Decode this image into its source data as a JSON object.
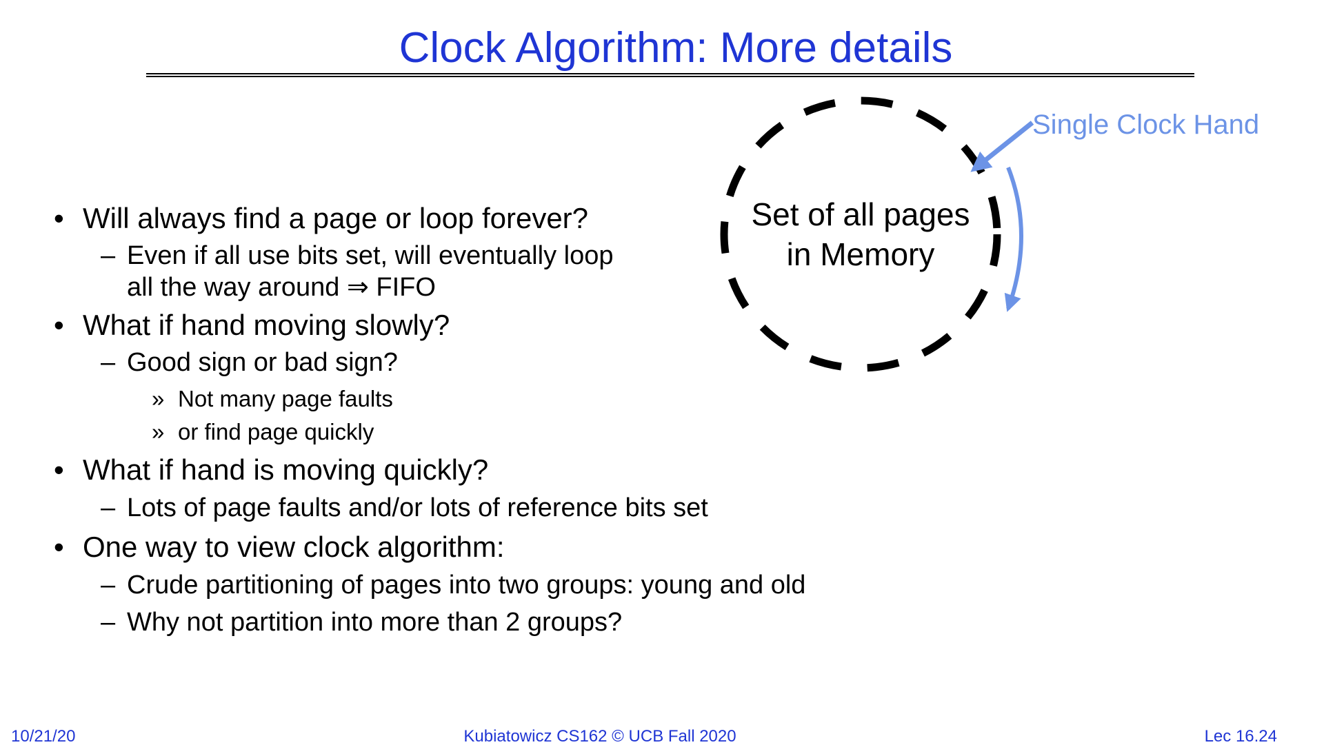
{
  "slide": {
    "title": "Clock Algorithm: More details",
    "bullet_glyph": "•",
    "dash_glyph": "–",
    "sub_glyph": "»",
    "items": [
      {
        "text": "Will always find a page or loop forever?"
      },
      {
        "text": "Even if all use bits set, will eventually loop"
      },
      {
        "text": "all the way around ⇒ FIFO"
      },
      {
        "text": "What if hand moving slowly?"
      },
      {
        "text": "Good sign or bad sign?"
      },
      {
        "text": "Not many page faults"
      },
      {
        "text": "or find page quickly"
      },
      {
        "text": "What if hand is moving quickly?"
      },
      {
        "text": "Lots of page faults and/or lots of reference bits set"
      },
      {
        "text": "One way to view clock algorithm:"
      },
      {
        "text": "Crude partitioning of pages into two groups: young and old"
      },
      {
        "text": "Why not partition into more than 2 groups?"
      }
    ]
  },
  "diagram": {
    "circle_label_line1": "Set of all pages",
    "circle_label_line2": "in Memory",
    "hand_label": "Single Clock Hand",
    "hand_color": "#6c93e6"
  },
  "footer": {
    "date": "10/21/20",
    "center": "Kubiatowicz CS162 © UCB Fall 2020",
    "lecture": "Lec 16.24"
  },
  "colors": {
    "title": "#1f35d4",
    "footer": "#1f35d4",
    "accent": "#6c93e6"
  }
}
